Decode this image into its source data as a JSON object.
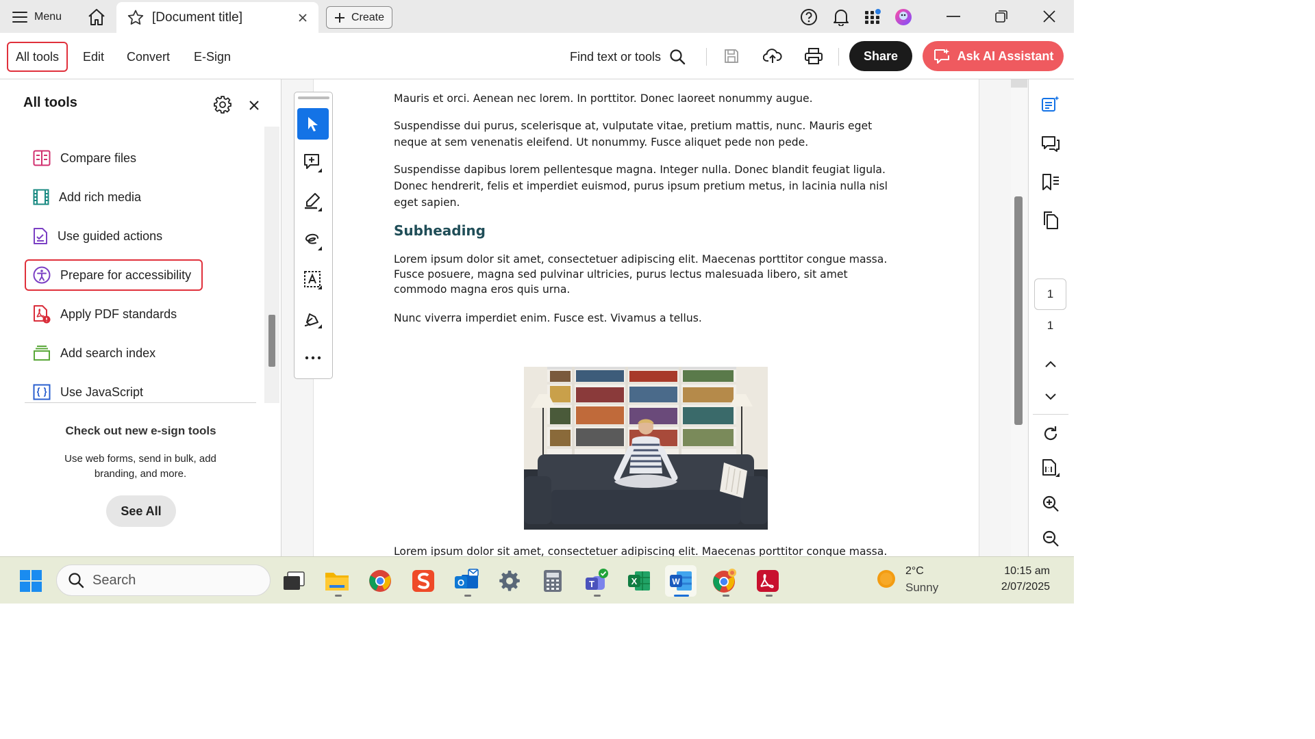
{
  "titlebar": {
    "menu_label": "Menu",
    "tab_title": "[Document title]",
    "create_label": "Create"
  },
  "toolbar": {
    "tabs": [
      "All tools",
      "Edit",
      "Convert",
      "E-Sign"
    ],
    "find_label": "Find text or tools",
    "share_label": "Share",
    "ai_label": "Ask AI Assistant"
  },
  "left_panel": {
    "title": "All tools",
    "items": [
      {
        "label": "Compare files",
        "icon": "compare-files-icon"
      },
      {
        "label": "Add rich media",
        "icon": "rich-media-icon"
      },
      {
        "label": "Use guided actions",
        "icon": "guided-actions-icon"
      },
      {
        "label": "Prepare for accessibility",
        "icon": "accessibility-icon",
        "selected": true
      },
      {
        "label": "Apply PDF standards",
        "icon": "pdf-standards-icon"
      },
      {
        "label": "Add search index",
        "icon": "search-index-icon"
      },
      {
        "label": "Use JavaScript",
        "icon": "javascript-icon"
      }
    ],
    "promo_title": "Check out new e-sign tools",
    "promo_desc": "Use web forms, send in bulk, add branding, and more.",
    "see_all_label": "See All"
  },
  "document": {
    "paragraphs": [
      "Mauris et orci. Aenean nec lorem. In porttitor. Donec laoreet nonummy augue.",
      "Suspendisse dui purus, scelerisque at, vulputate vitae, pretium mattis, nunc. Mauris eget neque at sem venenatis eleifend. Ut nonummy. Fusce aliquet pede non pede.",
      "Suspendisse dapibus lorem pellentesque magna. Integer nulla. Donec blandit feugiat ligula. Donec hendrerit, felis et imperdiet euismod, purus ipsum pretium metus, in lacinia nulla nisl eget sapien."
    ],
    "subheading": "Subheading",
    "paragraphs_after": [
      "Lorem ipsum dolor sit amet, consectetuer adipiscing elit. Maecenas porttitor congue massa. Fusce posuere, magna sed pulvinar ultricies, purus lectus malesuada libero, sit amet commodo magna eros quis urna.",
      "Nunc viverra imperdiet enim. Fusce est. Vivamus a tellus."
    ],
    "bottom_line": "Lorem ipsum dolor sit amet, consectetuer adipiscing elit. Maecenas porttitor congue massa."
  },
  "page_nav": {
    "current_page": "1",
    "total_pages": "1"
  },
  "taskbar": {
    "search_placeholder": "Search",
    "weather_temp": "2°C",
    "weather_desc": "Sunny",
    "time": "10:15 am",
    "date": "2/07/2025"
  },
  "colors": {
    "accent_red": "#e0303b",
    "ai_button": "#ef5a5f",
    "share_button": "#1b1b1b",
    "select_blue": "#1473e6",
    "subheading": "#1f4d57"
  }
}
